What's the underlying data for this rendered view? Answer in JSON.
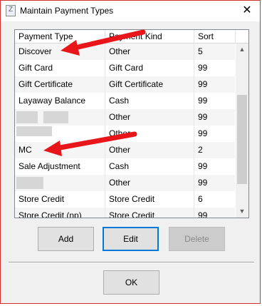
{
  "window": {
    "title": "Maintain Payment Types"
  },
  "titlebar": {
    "app_icon_letter": "Z",
    "close_glyph": "✕"
  },
  "grid": {
    "columns": [
      "Payment Type",
      "Payment Kind",
      "Sort"
    ],
    "rows": [
      [
        "Discover",
        "Other",
        "5"
      ],
      [
        "Gift Card",
        "Gift Card",
        "99"
      ],
      [
        "Gift Certificate",
        "Gift Certificate",
        "99"
      ],
      [
        "Layaway Balance",
        "Cash",
        "99"
      ],
      [
        "",
        "Other",
        "99"
      ],
      [
        "",
        "Other",
        "99"
      ],
      [
        "MC",
        "Other",
        "2"
      ],
      [
        "Sale Adjustment",
        "Cash",
        "99"
      ],
      [
        "",
        "Other",
        "99"
      ],
      [
        "Store Credit",
        "Store Credit",
        "6"
      ],
      [
        "Store Credit (np)",
        "Store Credit",
        "99"
      ]
    ]
  },
  "scrollbar": {
    "up_glyph": "▲",
    "down_glyph": "▼"
  },
  "buttons": {
    "add": "Add",
    "edit": "Edit",
    "delete": "Delete",
    "ok": "OK"
  },
  "colors": {
    "annotation_arrow": "#e8161b",
    "focus_border": "#0078d7"
  }
}
